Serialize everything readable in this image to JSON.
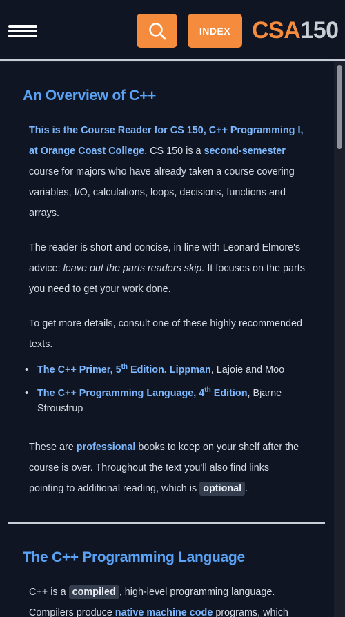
{
  "header": {
    "search_icon": "search-icon",
    "index_label": "INDEX",
    "brand_prefix": "CSA",
    "brand_suffix": "150",
    "accent": "#f58b3c"
  },
  "section1": {
    "title": "An Overview of C++",
    "p1_link": "This is the Course Reader for CS 150, C++ Programming I, at Orange Coast College",
    "p1_mid": ". CS 150 is a ",
    "p1_link2": "second-semester",
    "p1_end": " course for majors who have already taken a course covering variables, I/O, calculations, loops, decisions, functions and arrays.",
    "p2_start": "The reader is short and concise, in line with Leonard Elmore's advice: ",
    "p2_em": "leave out the parts readers skip.",
    "p2_end": " It focuses on the parts you need to get your work done.",
    "p3": "To get more details, consult one of these highly recommended texts.",
    "books": [
      {
        "link_a": "The C++ Primer, 5",
        "sup": "th",
        "link_b": " Edition. Lippman",
        "rest": ", Lajoie and Moo"
      },
      {
        "link_a": "The C++ Programming Language, 4",
        "sup": "th",
        "link_b": " Edition",
        "rest": ", Bjarne Stroustrup"
      }
    ],
    "p4_start": "These are ",
    "p4_link": "professional",
    "p4_mid": " books to keep on your shelf after the course is over. Throughout the text you'll also find links pointing to additional reading, which is ",
    "p4_code": "optional",
    "p4_end": "."
  },
  "section2": {
    "title": "The C++ Programming Language",
    "p1_start": "C++ is a ",
    "p1_code": "compiled",
    "p1_mid": ", high-level programming language.",
    "p2_start": "Compilers produce ",
    "p2_link": "native machine code",
    "p2_end": " programs, which"
  }
}
